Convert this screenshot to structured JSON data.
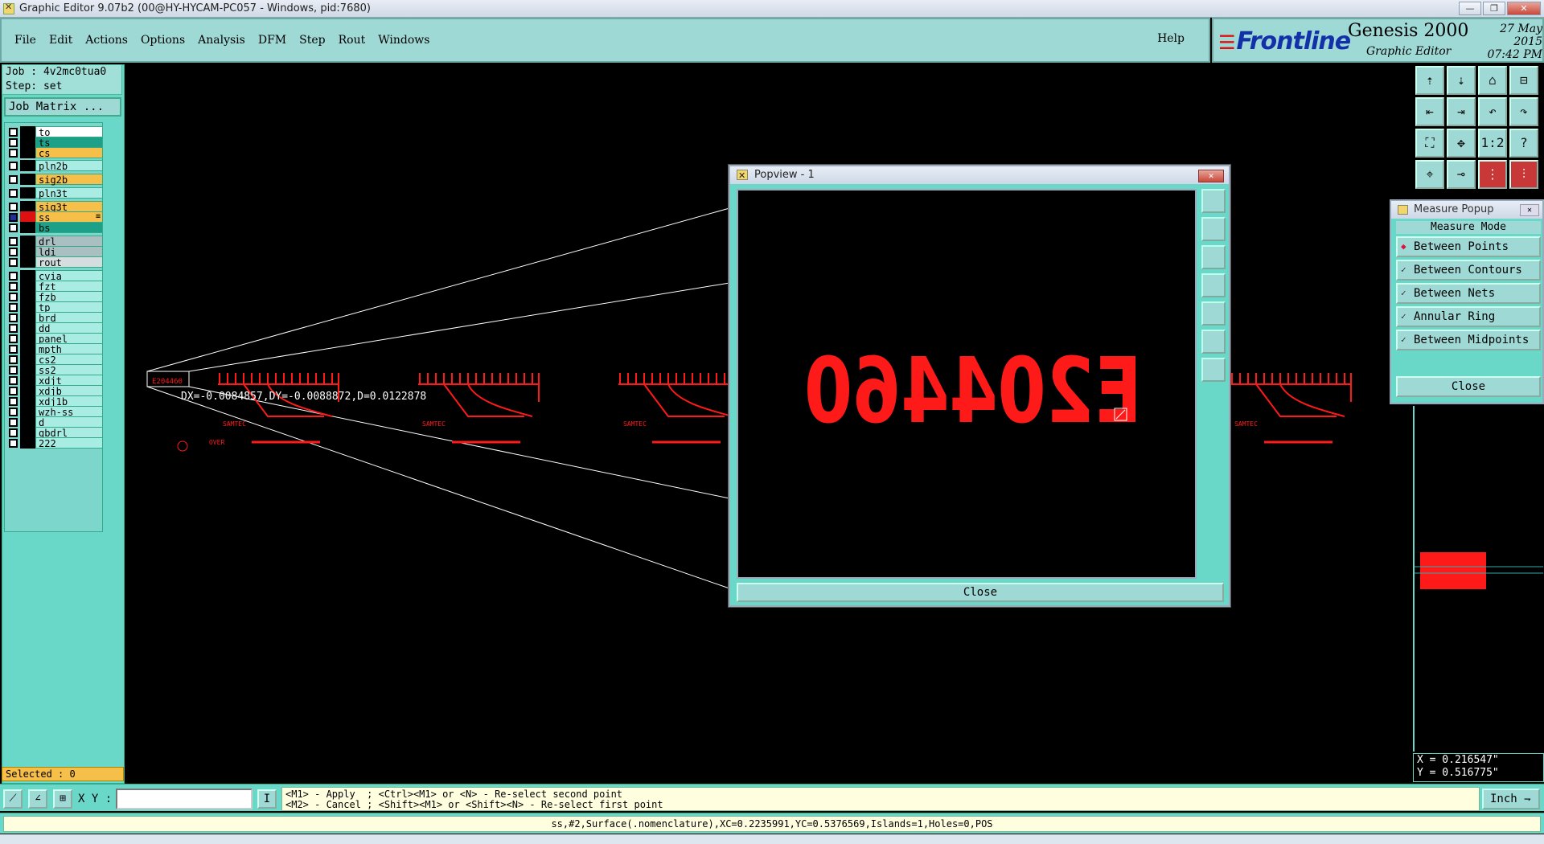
{
  "window": {
    "title": "Graphic Editor 9.07b2 (00@HY-HYCAM-PC057 - Windows, pid:7680)",
    "minimize": "—",
    "maximize": "❐",
    "close": "✕"
  },
  "menu": {
    "items": [
      "File",
      "Edit",
      "Actions",
      "Options",
      "Analysis",
      "DFM",
      "Step",
      "Rout",
      "Windows"
    ],
    "help": "Help"
  },
  "brand": {
    "logo": "Frontline",
    "product": "Genesis 2000",
    "subtitle": "Graphic Editor",
    "date": "27 May 2015",
    "time": "07:42 PM"
  },
  "job": {
    "job_label": "Job : 4v2mc0tua0",
    "step_label": "Step: set",
    "matrix_button": "Job Matrix ..."
  },
  "layers": [
    {
      "name": "to",
      "style": "on"
    },
    {
      "name": "ts",
      "style": "g"
    },
    {
      "name": "cs",
      "style": "hl"
    },
    {
      "name": "pln2b",
      "style": "def"
    },
    {
      "name": "sig2b",
      "style": "hl"
    },
    {
      "name": "pln3t",
      "style": "def"
    },
    {
      "name": "sig3t",
      "style": "hl"
    },
    {
      "name": "ss",
      "style": "hl",
      "active": true,
      "mark": "≡"
    },
    {
      "name": "bs",
      "style": "g"
    },
    {
      "name": "drl",
      "style": "grey"
    },
    {
      "name": "ldi",
      "style": "grey"
    },
    {
      "name": "rout",
      "style": "lt"
    },
    {
      "name": "cvia",
      "style": "def"
    },
    {
      "name": "fzt",
      "style": "def"
    },
    {
      "name": "fzb",
      "style": "def"
    },
    {
      "name": "tp",
      "style": "def"
    },
    {
      "name": "brd",
      "style": "def"
    },
    {
      "name": "dd",
      "style": "def"
    },
    {
      "name": "panel",
      "style": "def"
    },
    {
      "name": "mpth",
      "style": "def"
    },
    {
      "name": "cs2",
      "style": "def"
    },
    {
      "name": "ss2",
      "style": "def"
    },
    {
      "name": "xdjt",
      "style": "def"
    },
    {
      "name": "xdjb",
      "style": "def"
    },
    {
      "name": "xdj1b",
      "style": "def"
    },
    {
      "name": "wzh-ss",
      "style": "def"
    },
    {
      "name": "d",
      "style": "def"
    },
    {
      "name": "gbdrl",
      "style": "def"
    },
    {
      "name": "222",
      "style": "def"
    }
  ],
  "selected_label": "Selected : 0",
  "measurement_text": "DX=-0.0084857,DY=-0.0088872,D=0.0122878",
  "canvas": {
    "board_label": "E204460",
    "pcb_texts": [
      "SAMTEC",
      "OVER",
      "SAMTEC",
      "SAMTEC",
      "SAMTEC"
    ],
    "red": "#ff1a1a",
    "line": "#ffffff"
  },
  "popview": {
    "title": "Popview - 1",
    "zoom_text": "E204460",
    "close": "Close"
  },
  "measure_popup": {
    "title": "Measure Popup",
    "mode_label": "Measure Mode",
    "options": [
      {
        "label": "Between Points",
        "selected": true
      },
      {
        "label": "Between Contours",
        "selected": false
      },
      {
        "label": "Between Nets",
        "selected": false
      },
      {
        "label": "Annular Ring",
        "selected": false
      },
      {
        "label": "Between Midpoints",
        "selected": false
      }
    ],
    "close": "Close"
  },
  "right_tools": [
    "zoom-in-icon",
    "zoom-out-icon",
    "home-icon",
    "window-icon",
    "pan-left-icon",
    "pan-right-icon",
    "undo-zoom-icon",
    "redo-zoom-icon",
    "fit-icon",
    "center-icon",
    "one-to-one-icon",
    "help-icon",
    "snap-icon",
    "measure-icon",
    "connect-icon",
    "filter-icon"
  ],
  "coords": {
    "x": "X = 0.216547\"",
    "y": "Y = 0.516775\""
  },
  "bottom": {
    "xy_label": "X Y :",
    "xy_value": "",
    "i_button": "I",
    "hint_line1": "<M1> - Apply  ; <Ctrl><M1> or <N> - Re-select second point",
    "hint_line2": "<M2> - Cancel ; <Shift><M1> or <Shift><N> - Re-select first point",
    "units": "Inch"
  },
  "status_line": "ss,#2,Surface(.nomenclature),XC=0.2235991,YC=0.5376569,Islands=1,Holes=0,POS"
}
